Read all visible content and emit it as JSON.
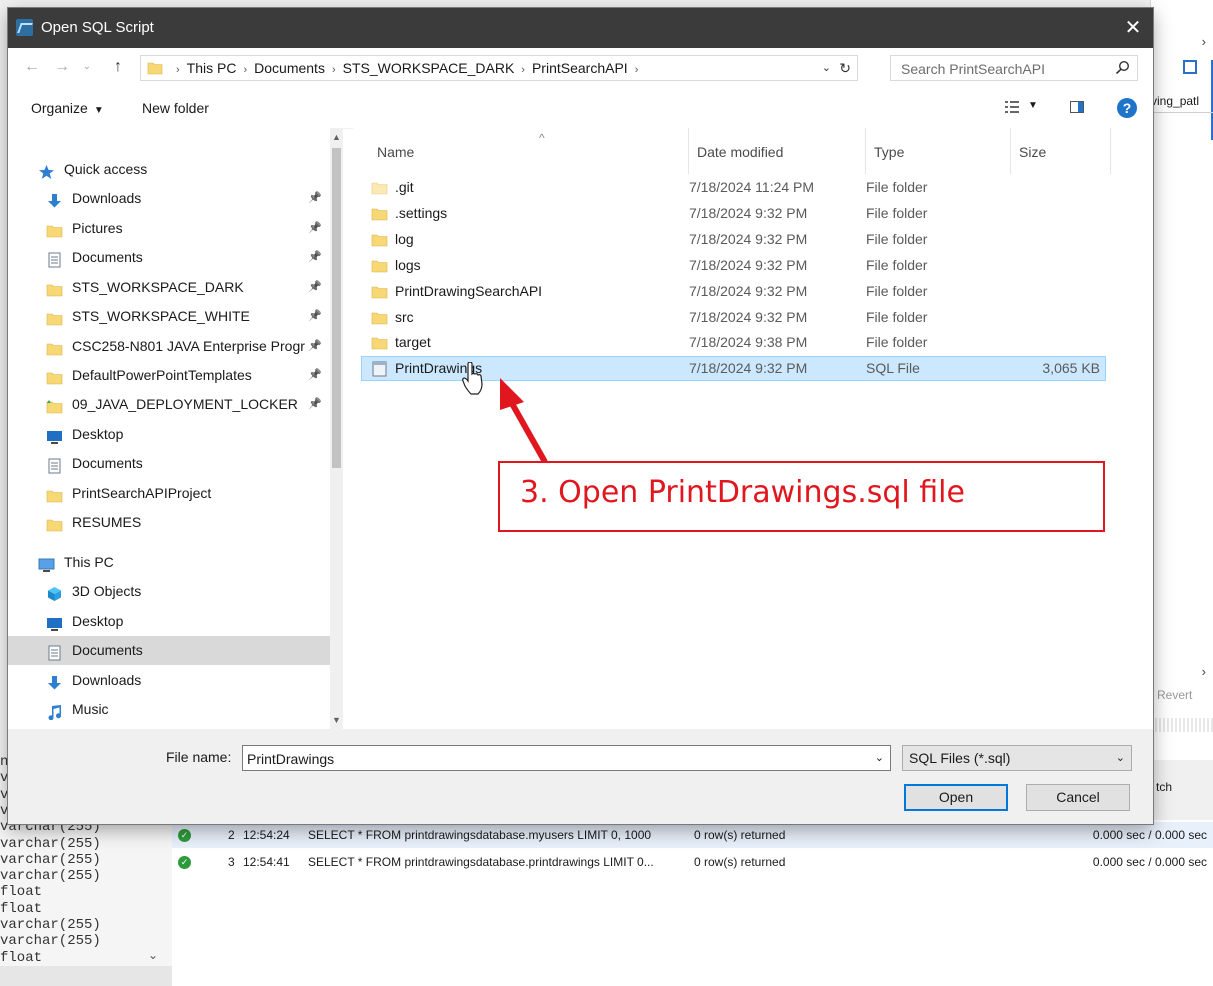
{
  "background": {
    "right_panel": {
      "header_text": "ving_patl",
      "revert_label": "Revert",
      "fetch_label": "tch"
    },
    "column_types": [
      "n",
      "va",
      "va",
      "va",
      "varchar(255)",
      "varchar(255)",
      "varchar(255)",
      "varchar(255)",
      "float",
      "float",
      "varchar(255)",
      "varchar(255)",
      "float"
    ],
    "output_log": [
      {
        "num": "2",
        "time": "12:54:24",
        "action": "SELECT * FROM printdrawingsdatabase.myusers LIMIT 0, 1000",
        "message": "0 row(s) returned",
        "duration": "0.000 sec / 0.000 sec"
      },
      {
        "num": "3",
        "time": "12:54:41",
        "action": "SELECT * FROM printdrawingsdatabase.printdrawings LIMIT 0...",
        "message": "0 row(s) returned",
        "duration": "0.000 sec / 0.000 sec"
      }
    ]
  },
  "dialog": {
    "title": "Open SQL Script",
    "close_glyph": "✕",
    "breadcrumbs": [
      "This PC",
      "Documents",
      "STS_WORKSPACE_DARK",
      "PrintSearchAPI"
    ],
    "search_placeholder": "Search PrintSearchAPI",
    "toolbar": {
      "organize": "Organize",
      "new_folder": "New folder",
      "help": "?"
    },
    "nav": [
      {
        "label": "Quick access",
        "icon": "star-icon",
        "pinned": false
      },
      {
        "label": "Downloads",
        "icon": "download-icon",
        "pinned": true
      },
      {
        "label": "Pictures",
        "icon": "folder-icon",
        "pinned": true
      },
      {
        "label": "Documents",
        "icon": "documents-icon",
        "pinned": true
      },
      {
        "label": "STS_WORKSPACE_DARK",
        "icon": "folder-icon",
        "pinned": true
      },
      {
        "label": "STS_WORKSPACE_WHITE",
        "icon": "folder-icon",
        "pinned": true
      },
      {
        "label": "CSC258-N801 JAVA Enterprise Progr",
        "icon": "folder-icon",
        "pinned": true
      },
      {
        "label": "DefaultPowerPointTemplates",
        "icon": "folder-icon",
        "pinned": true
      },
      {
        "label": "09_JAVA_DEPLOYMENT_LOCKER",
        "icon": "folder-sync-icon",
        "pinned": true
      },
      {
        "label": "Desktop",
        "icon": "desktop-icon",
        "pinned": false
      },
      {
        "label": "Documents",
        "icon": "documents-icon",
        "pinned": false
      },
      {
        "label": "PrintSearchAPIProject",
        "icon": "folder-icon",
        "pinned": false
      },
      {
        "label": "RESUMES",
        "icon": "folder-icon",
        "pinned": false
      },
      {
        "label": "This PC",
        "icon": "computer-icon",
        "pinned": false
      },
      {
        "label": "3D Objects",
        "icon": "cube-icon",
        "pinned": false
      },
      {
        "label": "Desktop",
        "icon": "desktop-icon",
        "pinned": false
      },
      {
        "label": "Documents",
        "icon": "documents-icon",
        "pinned": false,
        "selected": true
      },
      {
        "label": "Downloads",
        "icon": "download-icon",
        "pinned": false
      },
      {
        "label": "Music",
        "icon": "music-icon",
        "pinned": false
      },
      {
        "label": "Pictures",
        "icon": "pictures-icon",
        "pinned": false
      }
    ],
    "columns": {
      "name": "Name",
      "date": "Date modified",
      "type": "Type",
      "size": "Size"
    },
    "files": [
      {
        "name": ".git",
        "date": "7/18/2024 11:24 PM",
        "type": "File folder",
        "size": "",
        "icon": "folder-faded-icon"
      },
      {
        "name": ".settings",
        "date": "7/18/2024 9:32 PM",
        "type": "File folder",
        "size": "",
        "icon": "folder-icon"
      },
      {
        "name": "log",
        "date": "7/18/2024 9:32 PM",
        "type": "File folder",
        "size": "",
        "icon": "folder-icon"
      },
      {
        "name": "logs",
        "date": "7/18/2024 9:32 PM",
        "type": "File folder",
        "size": "",
        "icon": "folder-icon"
      },
      {
        "name": "PrintDrawingSearchAPI",
        "date": "7/18/2024 9:32 PM",
        "type": "File folder",
        "size": "",
        "icon": "folder-icon"
      },
      {
        "name": "src",
        "date": "7/18/2024 9:32 PM",
        "type": "File folder",
        "size": "",
        "icon": "folder-icon"
      },
      {
        "name": "target",
        "date": "7/18/2024 9:38 PM",
        "type": "File folder",
        "size": "",
        "icon": "folder-icon"
      },
      {
        "name": "PrintDrawings",
        "date": "7/18/2024 9:32 PM",
        "type": "SQL File",
        "size": "3,065 KB",
        "icon": "sql-file-icon",
        "selected": true
      }
    ],
    "file_name_label": "File name:",
    "file_name_value": "PrintDrawings",
    "file_type": "SQL Files (*.sql)",
    "open_label": "Open",
    "cancel_label": "Cancel"
  },
  "annotation": {
    "text": "3. Open PrintDrawings.sql file",
    "color": "#e0171e"
  },
  "colors": {
    "accent": "#0078d7",
    "selection": "#cce8ff",
    "folder": "#f8d775",
    "titlebar": "#3b3b3b"
  }
}
